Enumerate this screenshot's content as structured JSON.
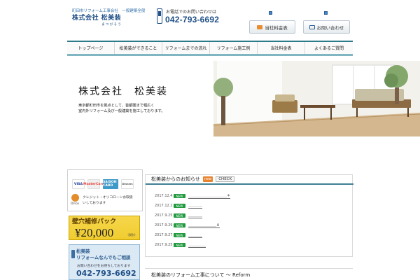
{
  "header": {
    "logo_line1": "町田市リフォーム工事会社　一般建築全般",
    "logo_company": "株式会社 松美装",
    "logo_kana": "まつびそう",
    "phone_caption": "お電話でのお問い合わせは",
    "phone_number": "042-793-6692",
    "btn_price": "当社料金表",
    "btn_contact": "お問い合わせ"
  },
  "nav": {
    "items": [
      "トップページ",
      "松美装ができること",
      "リフォームまでの流れ",
      "リフォーム施工例",
      "当社料金表",
      "よくあるご質問"
    ]
  },
  "hero": {
    "title": "株式会社　松美装",
    "desc1": "東京都町田市を拠点として、首都圏まで幅広く",
    "desc2": "室内外リフォーム及び一般建築を施工しております。"
  },
  "sidebar": {
    "cards": [
      "VISA",
      "MasterCard",
      "SAISON CARD",
      "Dinners"
    ],
    "orico_label": "Orico",
    "credit_text1": "クレジット・オリコローンお取扱",
    "credit_text2": "いしております",
    "paid_title": "壁穴補修パック",
    "paid_price": "¥20,000",
    "paid_tax": "（税別）",
    "consult_title1": "松美装",
    "consult_title2": "リフォームなんでもご相談",
    "consult_sub": "お問い合わせをお待ちしております",
    "consult_phone": "042-793-6692"
  },
  "news": {
    "title": "松美装からのお知らせ",
    "badge": "new",
    "check": "CHECK",
    "rows": [
      {
        "date": "2017.12.4",
        "new": "NEW",
        "text": "＿＿＿＿＿＿＿＿＿＿＿＊"
      },
      {
        "date": "2017.12.2",
        "new": "NEW",
        "text": "＿＿＿＿"
      },
      {
        "date": "2017.9.25",
        "new": "NEW",
        "text": "＿＿＿＿"
      },
      {
        "date": "2017.9.29",
        "new": "NEW",
        "text": "＿＿＿＿＿＿＿＿Ａ"
      },
      {
        "date": "2017.9.27",
        "new": "NEW",
        "text": "＿＿＿＿"
      },
      {
        "date": "2017.9.25",
        "new": "NEW",
        "text": "＿＿＿＿＿"
      }
    ]
  },
  "reform": {
    "title": "松美装のリフォーム工事について ～ Reform"
  },
  "colors": {
    "navy": "#1f4f86",
    "teal": "#2d7a8a",
    "yellow": "#f0cc2f",
    "green": "#1f9a3e"
  }
}
